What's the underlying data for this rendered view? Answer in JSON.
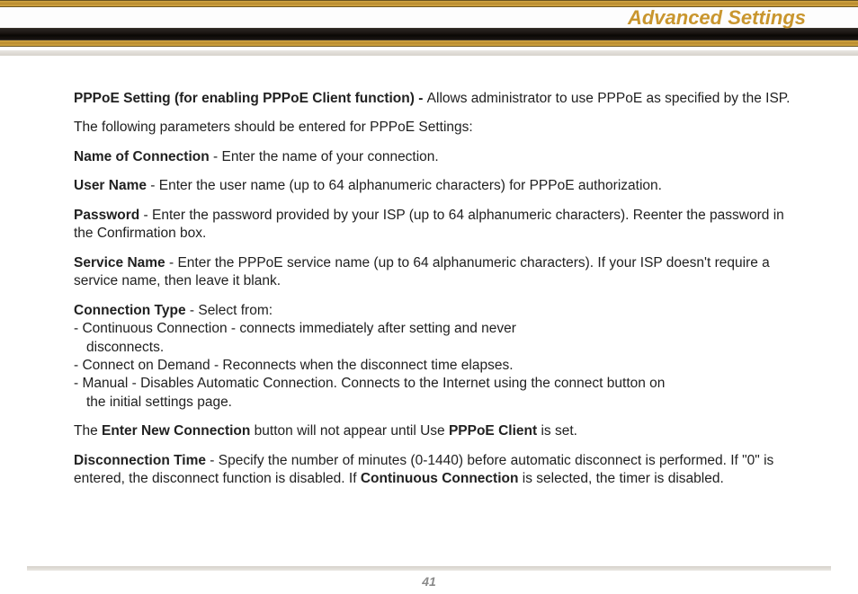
{
  "header": {
    "title": "Advanced Settings"
  },
  "content": {
    "intro": {
      "bold": "PPPoE Setting (for enabling PPPoE Client function) - ",
      "rest": "Allows administrator to use PPPoE as specified by the ISP."
    },
    "lead": "The following parameters should be entered for PPPoE Settings:",
    "name_of_connection": {
      "bold": "Name of Connection",
      "rest": " - Enter the name of your connection."
    },
    "user_name": {
      "bold": "User Name",
      "rest": " - Enter the user name (up to 64 alphanumeric characters) for PPPoE authorization."
    },
    "password": {
      "bold": "Password",
      "rest": " - Enter the password provided by your ISP (up to 64 alphanumeric characters).  Reenter the password in the Confirmation box."
    },
    "service_name": {
      "bold": "Service Name",
      "rest": " - Enter the PPPoE service name (up to 64 alphanumeric characters).  If your ISP doesn't require a service name, then leave it blank."
    },
    "connection_type": {
      "header_bold": "Connection Type",
      "header_rest": " - Select from:",
      "line1": "- Continuous Connection - connects immediately after setting and never",
      "line1b": "disconnects.",
      "line2": "- Connect on Demand - Reconnects when the disconnect time elapses.",
      "line3": "- Manual - Disables Automatic Connection.  Connects to the Internet using  the connect button on",
      "line3b": "the initial settings page."
    },
    "enter_new": {
      "pre": "The ",
      "bold1": "Enter New Connection",
      "mid": " button will not appear until Use ",
      "bold2": "PPPoE Client",
      "post": " is set."
    },
    "disconnection": {
      "bold": "Disconnection Time",
      "mid": " - Specify the number of minutes (0-1440) before automatic disconnect is performed.  If \"0\" is entered, the disconnect function is disabled.  If ",
      "bold2": "Continuous Connection",
      "post": " is selected, the timer is disabled."
    }
  },
  "footer": {
    "page_number": "41"
  }
}
